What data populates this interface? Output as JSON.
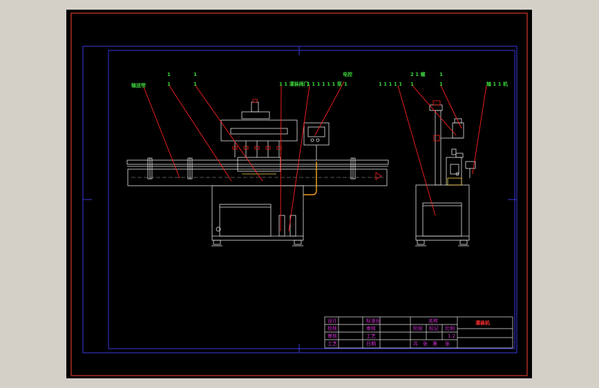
{
  "drawing": {
    "title_cell": "灌装机",
    "colors": {
      "background": "#000000",
      "outer_border": "#d9382c",
      "sheet_border": "#3a3ae0",
      "frame_line": "#e8e8e8",
      "leader_line": "#ff2020",
      "label_text": "#3cd23c",
      "pipe_line": "#f0a020",
      "title_block_text": "#d030d0"
    }
  },
  "callouts": {
    "front": [
      {
        "id": "c1",
        "text": "输送带"
      },
      {
        "id": "c2a",
        "text": "1"
      },
      {
        "id": "c2b",
        "text": "1"
      },
      {
        "id": "c3a",
        "text": "1"
      },
      {
        "id": "c3b",
        "text": "1"
      },
      {
        "id": "c4",
        "text": "1 1 灌装阀门"
      },
      {
        "id": "c5",
        "text": "1 1 1 1 1 1 泵"
      },
      {
        "id": "c6a",
        "text": "电控"
      },
      {
        "id": "c6b",
        "text": "1"
      }
    ],
    "side": [
      {
        "id": "s1",
        "text": "1 1 1 1 1"
      },
      {
        "id": "s2a",
        "text": "2 1 螺"
      },
      {
        "id": "s2b",
        "text": "1"
      },
      {
        "id": "s3a",
        "text": "1"
      },
      {
        "id": "s3b",
        "text": "1"
      },
      {
        "id": "s4",
        "text": "输 1 1 机"
      }
    ]
  },
  "front_view": {
    "conveyor_text": "—————————"
  },
  "title_block": {
    "left_rows": [
      [
        "设计",
        "",
        "标准化",
        ""
      ],
      [
        "校核",
        "",
        "审核",
        ""
      ],
      [
        "审核",
        "",
        "工艺",
        ""
      ],
      [
        "工艺",
        "",
        "日期",
        ""
      ]
    ],
    "mid_header": "名称",
    "mid_row": [
      "阶段",
      "标记",
      "比例"
    ],
    "mid_row2": [
      "",
      "",
      "1:2"
    ],
    "mid_footer": [
      "共",
      "张",
      "第",
      "张"
    ],
    "drawing_name": "灌装机"
  }
}
